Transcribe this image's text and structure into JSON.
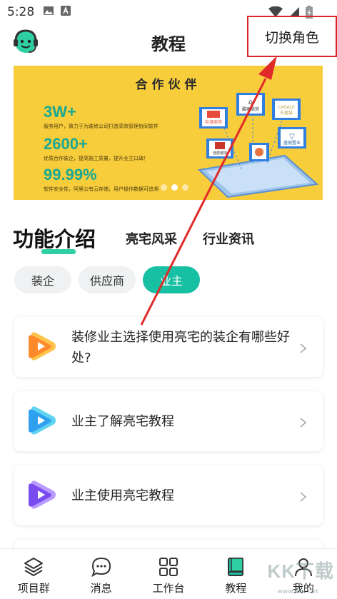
{
  "status_bar": {
    "time": "5:28",
    "icons": [
      "image-icon",
      "a-icon",
      "wifi-icon",
      "signal-icon",
      "battery-icon"
    ]
  },
  "header": {
    "title": "教程",
    "switch_role": "切换角色",
    "avatar_icon": "support-avatar-icon"
  },
  "banner": {
    "title": "合作伙伴",
    "stats": [
      {
        "value": "3W+",
        "desc": "服务用户，致力于为装修公司打造高效管理协同软件"
      },
      {
        "value": "2600+",
        "desc": "优质合作装企，提高施工质量，提升业主口碑！"
      },
      {
        "value": "99.99%",
        "desc": "软件安全性，阿里公有云存储，用户操作数据可追溯"
      }
    ],
    "partner_logos": [
      "中洛商饰",
      "酷家商饰",
      "CASALE 王居装",
      "盛舰置业",
      "佳居装饰"
    ],
    "slide_index": 1,
    "slide_count": 3
  },
  "section_tabs": {
    "main": "功能介绍",
    "items": [
      "亮宅风采",
      "行业资讯"
    ]
  },
  "role_chips": [
    {
      "label": "装企",
      "active": false
    },
    {
      "label": "供应商",
      "active": false
    },
    {
      "label": "业主",
      "active": true
    }
  ],
  "tutorials": [
    {
      "title": "装修业主选择使用亮宅的装企有哪些好处?",
      "icon_color": "#ff8a2b"
    },
    {
      "title": "业主了解亮宅教程",
      "icon_color": "#2f9ff0"
    },
    {
      "title": "业主使用亮宅教程",
      "icon_color": "#7a4cf0"
    }
  ],
  "bottom_nav": [
    {
      "label": "项目群",
      "icon": "layers-icon"
    },
    {
      "label": "消息",
      "icon": "chat-bubble-icon"
    },
    {
      "label": "工作台",
      "icon": "grid-icon"
    },
    {
      "label": "教程",
      "icon": "book-icon",
      "active": true
    },
    {
      "label": "我的",
      "icon": "person-icon"
    }
  ],
  "watermark": {
    "text": "KK下载",
    "url": "www.kkx.net"
  },
  "colors": {
    "accent": "#17bfa3",
    "banner": "#f7cd3b",
    "annotation": "#d9262c"
  }
}
